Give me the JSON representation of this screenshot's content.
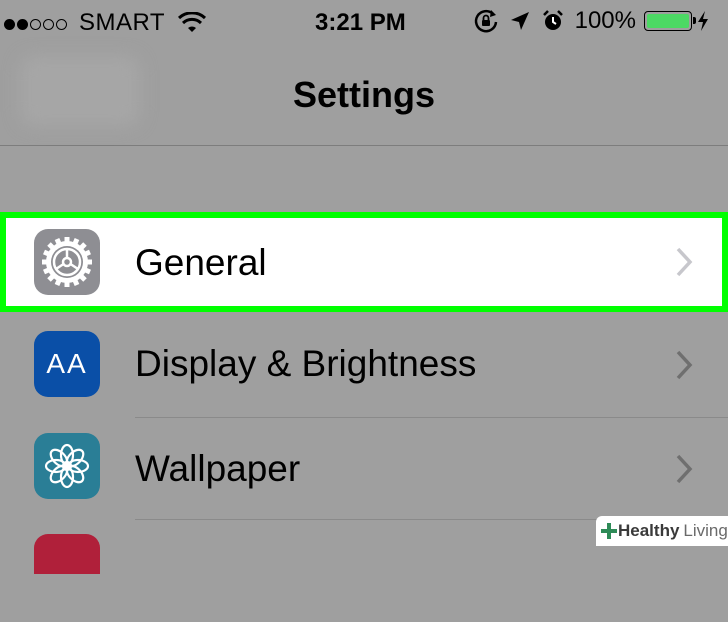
{
  "status_bar": {
    "carrier": "SMART",
    "time": "3:21 PM",
    "battery_percent": "100%",
    "battery_level": 1.0,
    "signal_bars_filled": 2,
    "signal_bars_total": 5,
    "icons": [
      "wifi-icon",
      "orientation-lock-icon",
      "location-icon",
      "alarm-icon",
      "battery-icon",
      "charging-icon"
    ]
  },
  "nav": {
    "title": "Settings"
  },
  "rows": [
    {
      "label": "General",
      "icon": "gear-icon",
      "icon_color": "#8e8e93",
      "highlighted": true,
      "highlight_color": "#00ff00"
    },
    {
      "label": "Display & Brightness",
      "icon": "text-size-icon",
      "icon_text": "AA",
      "icon_color": "#0a4fa7"
    },
    {
      "label": "Wallpaper",
      "icon": "flower-icon",
      "icon_color": "#2a7e96"
    },
    {
      "label": "",
      "icon": "red-app-icon",
      "icon_color": "#b0203a"
    }
  ],
  "watermark": {
    "brand": "Healthy",
    "suffix": "Living"
  }
}
